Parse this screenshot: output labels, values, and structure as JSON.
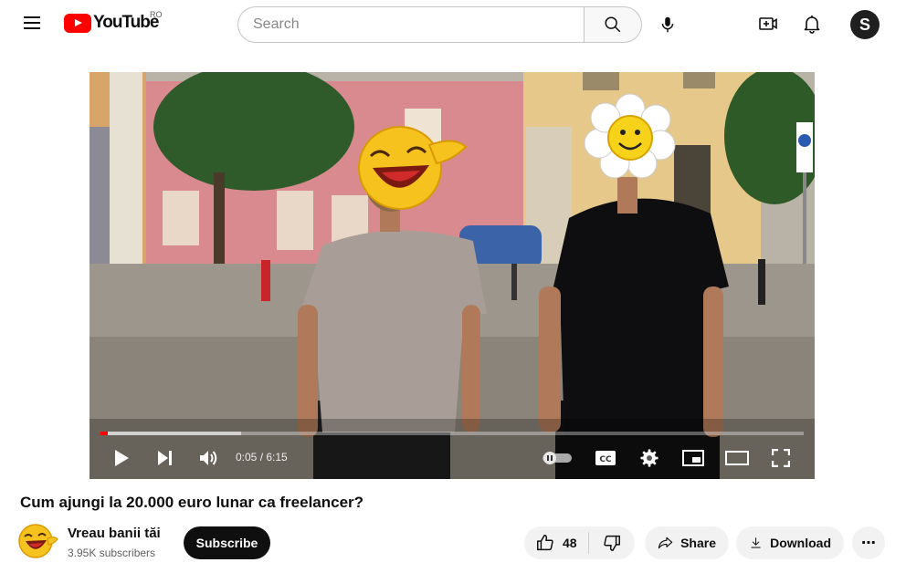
{
  "header": {
    "logo_text": "YouTube",
    "region": "RO",
    "search_placeholder": "Search",
    "avatar_letter": "S"
  },
  "player": {
    "time_display": "0:05 / 6:15",
    "played_fraction": 0.007,
    "loaded_fraction": 0.2
  },
  "video": {
    "title": "Cum ajungi la 20.000 euro lunar ca freelancer?"
  },
  "channel": {
    "name": "Vreau banii tăi",
    "subscribers": "3.95K subscribers",
    "subscribe_label": "Subscribe"
  },
  "actions": {
    "likes": "48",
    "share_label": "Share",
    "download_label": "Download",
    "more_label": "⋯"
  },
  "colors": {
    "brand_red": "#ff0000",
    "subscribe_bg": "#0f0f0f",
    "pill_bg": "#f2f2f2"
  }
}
